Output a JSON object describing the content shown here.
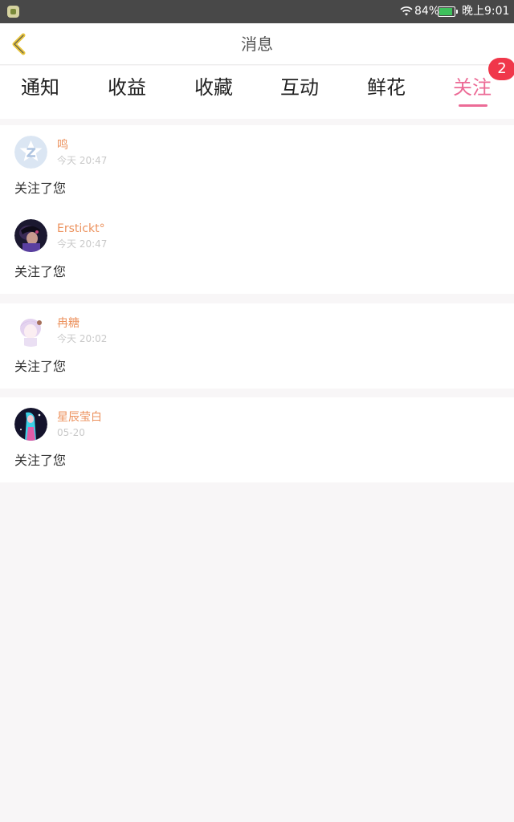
{
  "status_bar": {
    "app_icon": "notification-app-icon",
    "wifi_icon": "wifi-icon",
    "battery_percent": "84%",
    "battery_level": 0.84,
    "battery_color": "#3ec15c",
    "time": "晚上9:01"
  },
  "header": {
    "back_icon": "chevron-left-icon",
    "title": "消息"
  },
  "tabs": {
    "items": [
      {
        "label": "通知"
      },
      {
        "label": "收益"
      },
      {
        "label": "收藏"
      },
      {
        "label": "互动"
      },
      {
        "label": "鲜花"
      },
      {
        "label": "关注"
      }
    ],
    "active": "关注",
    "badge": "2"
  },
  "colors": {
    "accent_pink": "#ec6b96",
    "username_orange": "#ec925e",
    "badge_red": "#f0374a"
  },
  "notifications": [
    {
      "name": "鸣",
      "time": "今天 20:47",
      "message": "关注了您",
      "avatar": "default-avatar-icon"
    },
    {
      "name": "Erstickt°",
      "time": "今天 20:47",
      "message": "关注了您",
      "avatar": "user-avatar"
    },
    {
      "name": "冉糖",
      "time": "今天 20:02",
      "message": "关注了您",
      "avatar": "user-avatar"
    },
    {
      "name": "星辰莹白",
      "time": "05-20",
      "message": "关注了您",
      "avatar": "user-avatar"
    }
  ]
}
